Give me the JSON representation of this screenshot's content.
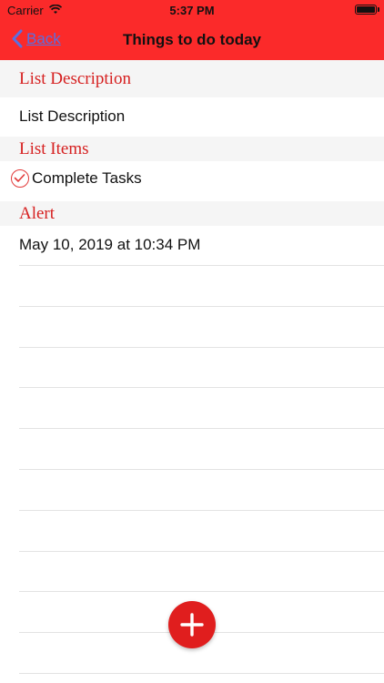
{
  "status_bar": {
    "carrier": "Carrier",
    "time": "5:37 PM"
  },
  "nav": {
    "back_label": "Back",
    "title": "Things to do today"
  },
  "sections": {
    "description_header": "List Description",
    "description_value": "List Description",
    "items_header": "List Items",
    "alert_header": "Alert",
    "alert_value": "May 10, 2019 at 10:34 PM"
  },
  "list_items": [
    {
      "label": "Complete Tasks",
      "checked": true
    }
  ],
  "colors": {
    "accent": "#fb2a2a",
    "header_text": "#d62020",
    "back_link": "#5a6fe0"
  },
  "icons": [
    "wifi-icon",
    "battery-icon",
    "back-chevron-icon",
    "check-icon",
    "plus-icon"
  ]
}
